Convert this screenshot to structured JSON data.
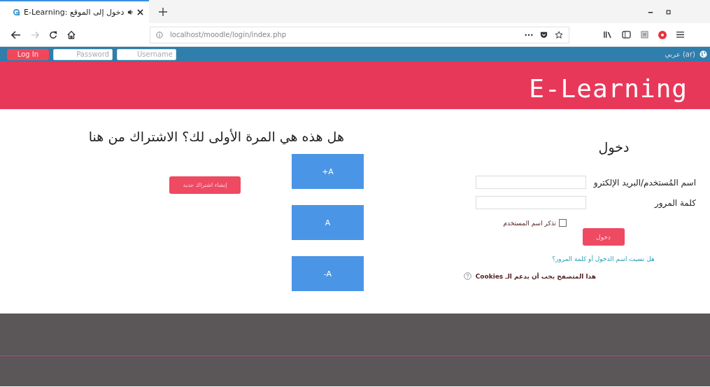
{
  "browser": {
    "tab": {
      "title": "E-Learning: دخول إلى الموقع",
      "selected": true
    },
    "address": "localhost/moodle/login/index.php"
  },
  "top_bar": {
    "login_button": "Log In",
    "password_placeholder": "Password",
    "username_placeholder": "Username",
    "language": "عربي (ar)"
  },
  "banner": {
    "logo": "E-Learning"
  },
  "signup": {
    "heading": "هل هذه هي المرة الأولى لك؟ الاشتراك من هنا",
    "button": "إنشاء اشتراك جديد"
  },
  "font_size_buttons": [
    "+A",
    "A",
    "-A"
  ],
  "login": {
    "title": "دخول",
    "username_label": "اسم المُستخدم/البريد الإلكترو",
    "password_label": "كلمة المرور",
    "remember": {
      "label": "تذكر اسم المستخدم",
      "checked": false
    },
    "button": "دخول",
    "forgot_link": "هل نسيت اسم الدخول أو كلمة المرور؟",
    "cookies_notice": "هذا المتصفح يجب أن يدعم الـ Cookies"
  }
}
